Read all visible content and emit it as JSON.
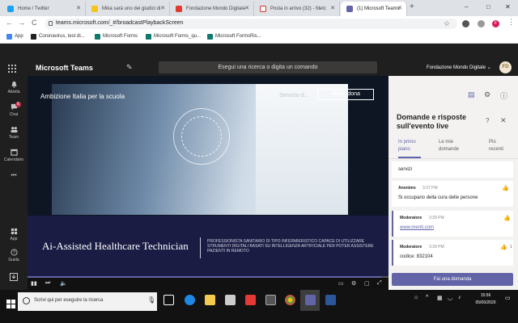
{
  "browser": {
    "tabs": [
      {
        "title": "Home / Twitter",
        "fav_color": "#1da1f2",
        "active": false
      },
      {
        "title": "Mika sarà uno dei giudici di",
        "fav_color": "#f5c518",
        "active": false
      },
      {
        "title": "Fondazione Mondo Digitale",
        "fav_color": "#e23a2f",
        "active": false
      },
      {
        "title": "Posta in arrivo (32) - fdelc",
        "fav_color": "#d93025",
        "active": false
      },
      {
        "title": "(1) Microsoft Teams",
        "fav_color": "#6264a7",
        "active": true
      }
    ],
    "new_tab": "+",
    "window": {
      "minimize": "–",
      "maximize": "□",
      "close": "✕"
    },
    "nav": {
      "back": "←",
      "forward": "→",
      "reload": "C"
    },
    "url": "teams.microsoft.com/_#/broadcastPlaybackScreen",
    "star": "☆",
    "profile_initial": "F"
  },
  "bookmarks": [
    {
      "label": "App",
      "color": "#4285f4"
    },
    {
      "label": "Coronavirus, test di...",
      "color": "#202124"
    },
    {
      "label": "Microsoft Forms",
      "color": "#0f7b6c"
    },
    {
      "label": "Microsoft Forms_qu...",
      "color": "#0f7b6c"
    },
    {
      "label": "Microsoft FormsRis...",
      "color": "#0f7b6c"
    }
  ],
  "teams": {
    "app_name": "Microsoft Teams",
    "search_placeholder": "Esegui una ricerca o digita un comando",
    "org_name": "Fondazione Mondo Digitale ⌄",
    "avatar_initials": "FD"
  },
  "rail": [
    {
      "label": "Attività",
      "badge": ""
    },
    {
      "label": "Chat",
      "badge": "6"
    },
    {
      "label": "Team",
      "badge": ""
    },
    {
      "label": "Calendario",
      "badge": ""
    },
    {
      "label": "•••",
      "badge": ""
    },
    {
      "label": "App",
      "badge": ""
    },
    {
      "label": "Guida",
      "badge": ""
    }
  ],
  "video": {
    "event_title": "Ambizione Italia per la scuola",
    "secure_label": "Servizio d...",
    "leave_button": "Abbandona",
    "banner_title": "Ai-Assisted Healthcare Technician",
    "banner_subtitle": "PROFESSIONISTA SANITARIO DI TIPO INFERMIERISTICO CAPACE DI UTILIZZARE STRUMENTI DIGITALI BASATI SU INTELLIGENZA ARTIFICIALE PER POTER ASSISTERE PAZIENTI IN REMOTO",
    "progress": 0.98
  },
  "qa_panel": {
    "title": "Domande e risposte sull'evento live",
    "help_icon": "?",
    "close_icon": "✕",
    "tabs": [
      {
        "label": "In primo piano",
        "active": true
      },
      {
        "label": "Le mie domande",
        "active": false
      },
      {
        "label": "Più recenti",
        "active": false
      }
    ],
    "partial_text": "servizi",
    "items": [
      {
        "author": "Anonimo",
        "time": "3:37 PM",
        "text": "Si occupano della cura delle persone",
        "is_link": false,
        "likes": "",
        "moderator": false
      },
      {
        "author": "Moderatore",
        "time": "3:39 PM",
        "text": "www.menti.com",
        "is_link": true,
        "likes": "",
        "moderator": true
      },
      {
        "author": "Moderatore",
        "time": "3:39 PM",
        "text": "codice: 832104",
        "is_link": false,
        "likes": "1",
        "moderator": true
      }
    ],
    "ask_button": "Fai una domanda"
  },
  "taskbar": {
    "search_placeholder": "Scrivi qui per eseguire la ricerca",
    "time": "15:56",
    "date": "05/06/2020"
  },
  "colors": {
    "teams_purple": "#6264a7",
    "teams_dark": "#201f1f",
    "banner_navy": "#1a1c44"
  }
}
